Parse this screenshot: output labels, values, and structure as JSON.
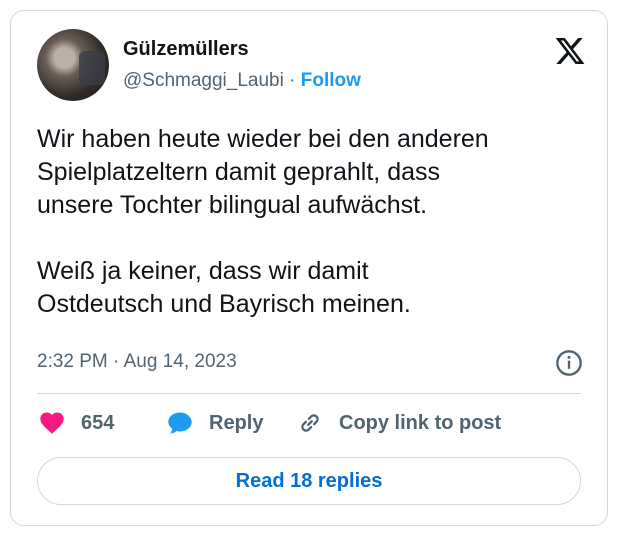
{
  "author": {
    "display_name": "Gülzemüllers",
    "handle": "@Schmaggi_Laubi",
    "separator": "·",
    "follow_label": "Follow"
  },
  "tweet": {
    "paragraphs": [
      [
        "Wir haben heute wieder bei den anderen",
        "Spielplatzeltern damit geprahlt, dass",
        "unsere Tochter bilingual aufwächst."
      ],
      [
        "Weiß ja keiner, dass wir damit",
        "Ostdeutsch und Bayrisch meinen."
      ]
    ],
    "timestamp": "2:32 PM · Aug 14, 2023"
  },
  "actions": {
    "like_count": "654",
    "reply_label": "Reply",
    "copy_label": "Copy link to post"
  },
  "read_replies_label": "Read 18 replies",
  "colors": {
    "accent": "#1d9bf0",
    "heart": "#f91880",
    "link": "#006fd6",
    "muted": "#536471",
    "border": "#cfd9de"
  },
  "icons": [
    "x-logo-icon",
    "info-icon",
    "heart-icon",
    "reply-bubble-icon",
    "link-icon"
  ]
}
